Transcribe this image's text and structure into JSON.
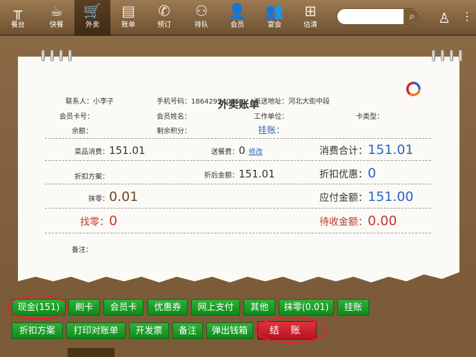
{
  "nav": {
    "items": [
      {
        "label": "餐台",
        "icon": "table-icon",
        "glyph": "╥"
      },
      {
        "label": "快餐",
        "icon": "drink-icon",
        "glyph": "☕"
      },
      {
        "label": "外卖",
        "icon": "cart-icon",
        "glyph": "🛒"
      },
      {
        "label": "账单",
        "icon": "bill-icon",
        "glyph": "▤"
      },
      {
        "label": "预订",
        "icon": "phone-icon",
        "glyph": "✆"
      },
      {
        "label": "排队",
        "icon": "queue-icon",
        "glyph": "⚇"
      },
      {
        "label": "会员",
        "icon": "member-icon",
        "glyph": "👤"
      },
      {
        "label": "宴会",
        "icon": "banquet-icon",
        "glyph": "👥"
      },
      {
        "label": "估清",
        "icon": "basket-icon",
        "glyph": "⊞"
      }
    ],
    "active_index": 2,
    "search_placeholder": "",
    "search_icon": "search-icon",
    "user_icon": "user-icon",
    "more_icon": "more-icon"
  },
  "bill": {
    "title": "外卖账单",
    "contact_label": "联系人：",
    "contact_value": "小李子",
    "phone_label": "手机号码：",
    "phone_value": "18642954085",
    "address_label": "派送地址：",
    "address_value": "河北大街中段",
    "card_no_label": "会员卡号：",
    "member_name_label": "会员姓名：",
    "work_unit_label": "工作单位：",
    "card_type_label": "卡类型：",
    "balance_label": "余额：",
    "points_label": "剩余积分：",
    "hang_label": "挂账：",
    "dish_label": "菜品消费：",
    "dish_value": "151.01",
    "delivery_label": "送餐费：",
    "delivery_value": "0",
    "modify_link": "修改",
    "total_label": "消费合计：",
    "total_value": "151.01",
    "discount_plan_label": "折扣方案：",
    "after_discount_label": "折后金额：",
    "after_discount_value": "151.01",
    "discount_label": "折扣优惠：",
    "discount_value": "0",
    "round_label": "抹零：",
    "round_value": "0.01",
    "payable_label": "应付金额：",
    "payable_value": "151.00",
    "change_label": "找零：",
    "change_value": "0",
    "pending_label": "待收金额：",
    "pending_value": "0.00",
    "remark_label": "备注："
  },
  "buttons": {
    "row1": [
      "现金(151)",
      "刷卡",
      "会员卡",
      "优惠券",
      "网上支付",
      "其他",
      "抹零(0.01)",
      "挂账"
    ],
    "row2": [
      "折扣方案",
      "打印对账单",
      "开发票",
      "备注",
      "弹出钱箱"
    ],
    "checkout": "结 账"
  },
  "colors": {
    "accent_blue": "#2c63c7",
    "accent_red": "#c0392b",
    "button_green": "#1a9a28",
    "button_red": "#c81e29"
  }
}
